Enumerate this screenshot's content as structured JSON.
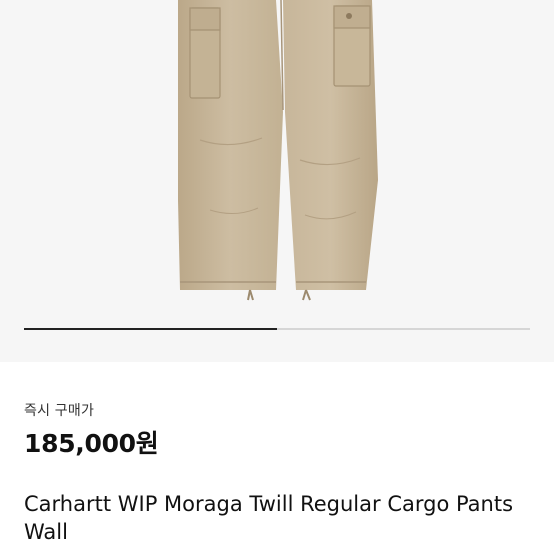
{
  "product": {
    "image_icon": "cargo-pants-photo",
    "gallery": {
      "active_fraction": 0.5
    },
    "price_label": "즉시 구매가",
    "price": "185,000원",
    "title": "Carhartt WIP Moraga Twill Regular Cargo Pants Wall"
  },
  "colors": {
    "background": "#ffffff",
    "image_background": "#f6f6f6",
    "fabric": "#c9b89c",
    "indicator_active": "#222222",
    "indicator_track": "#d6d6d6"
  }
}
